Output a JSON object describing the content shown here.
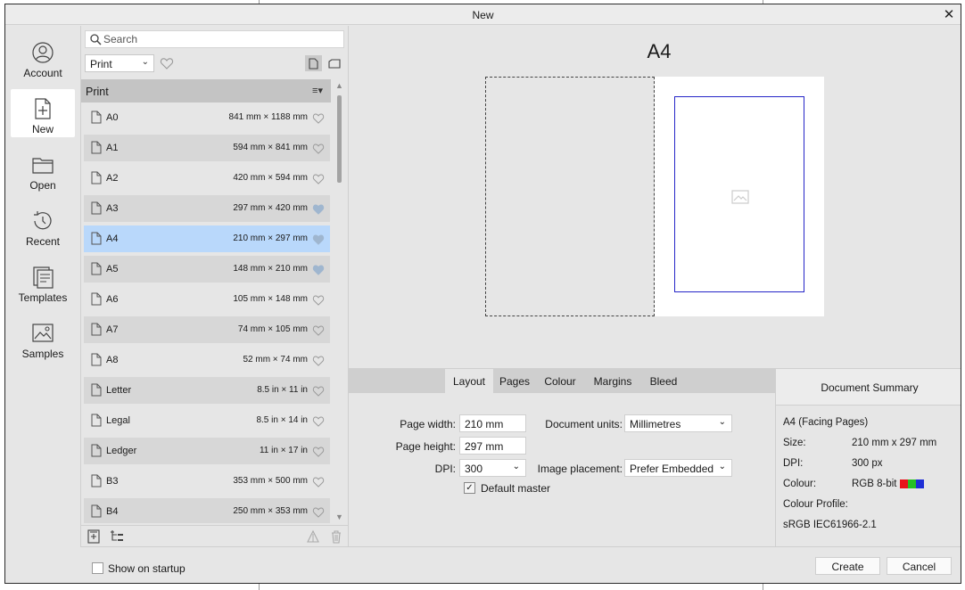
{
  "window": {
    "title": "New"
  },
  "nav": [
    {
      "label": "Account",
      "icon": "account-icon"
    },
    {
      "label": "New",
      "icon": "new-document-icon"
    },
    {
      "label": "Open",
      "icon": "folder-icon"
    },
    {
      "label": "Recent",
      "icon": "history-clock-icon"
    },
    {
      "label": "Templates",
      "icon": "templates-icon"
    },
    {
      "label": "Samples",
      "icon": "samples-image-icon"
    }
  ],
  "search": {
    "placeholder": "Search"
  },
  "category": {
    "selected": "Print"
  },
  "list": {
    "header": "Print",
    "rows": [
      {
        "name": "A0",
        "dims": "841 mm × 1188 mm",
        "fav": false
      },
      {
        "name": "A1",
        "dims": "594 mm × 841 mm",
        "fav": false
      },
      {
        "name": "A2",
        "dims": "420 mm × 594 mm",
        "fav": false
      },
      {
        "name": "A3",
        "dims": "297 mm × 420 mm",
        "fav": true
      },
      {
        "name": "A4",
        "dims": "210 mm × 297 mm",
        "fav": true
      },
      {
        "name": "A5",
        "dims": "148 mm × 210 mm",
        "fav": true
      },
      {
        "name": "A6",
        "dims": "105 mm × 148 mm",
        "fav": false
      },
      {
        "name": "A7",
        "dims": "74 mm × 105 mm",
        "fav": false
      },
      {
        "name": "A8",
        "dims": "52 mm × 74 mm",
        "fav": false
      },
      {
        "name": "Letter",
        "dims": "8.5 in × 11 in",
        "fav": false
      },
      {
        "name": "Legal",
        "dims": "8.5 in × 14 in",
        "fav": false
      },
      {
        "name": "Ledger",
        "dims": "11 in × 17 in",
        "fav": false
      },
      {
        "name": "B3",
        "dims": "353 mm × 500 mm",
        "fav": false
      },
      {
        "name": "B4",
        "dims": "250 mm × 353 mm",
        "fav": false
      }
    ],
    "selected_index": 4
  },
  "preview": {
    "title": "A4"
  },
  "tabs": [
    "Layout",
    "Pages",
    "Colour",
    "Margins",
    "Bleed"
  ],
  "layout": {
    "page_width_label": "Page width:",
    "page_width": "210 mm",
    "page_height_label": "Page height:",
    "page_height": "297 mm",
    "dpi_label": "DPI:",
    "dpi": "300",
    "units_label": "Document units:",
    "units": "Millimetres",
    "placement_label": "Image placement:",
    "placement": "Prefer Embedded",
    "default_master_label": "Default master",
    "default_master_checked": true
  },
  "summary": {
    "title": "Document Summary",
    "doc_type": "A4 (Facing Pages)",
    "size_label": "Size:",
    "size": "210 mm  x  297 mm",
    "dpi_label": "DPI:",
    "dpi": "300 px",
    "colour_label": "Colour:",
    "colour": "RGB 8-bit",
    "colour_swatches": [
      "#e8141b",
      "#26c026",
      "#1f2fd6"
    ],
    "profile_label": "Colour Profile:",
    "profile": "sRGB IEC61966-2.1"
  },
  "footer": {
    "show_on_startup": "Show on startup",
    "create": "Create",
    "cancel": "Cancel"
  },
  "colors": {
    "selection": "#b9d8fb",
    "margin_guide": "#2525c8"
  }
}
